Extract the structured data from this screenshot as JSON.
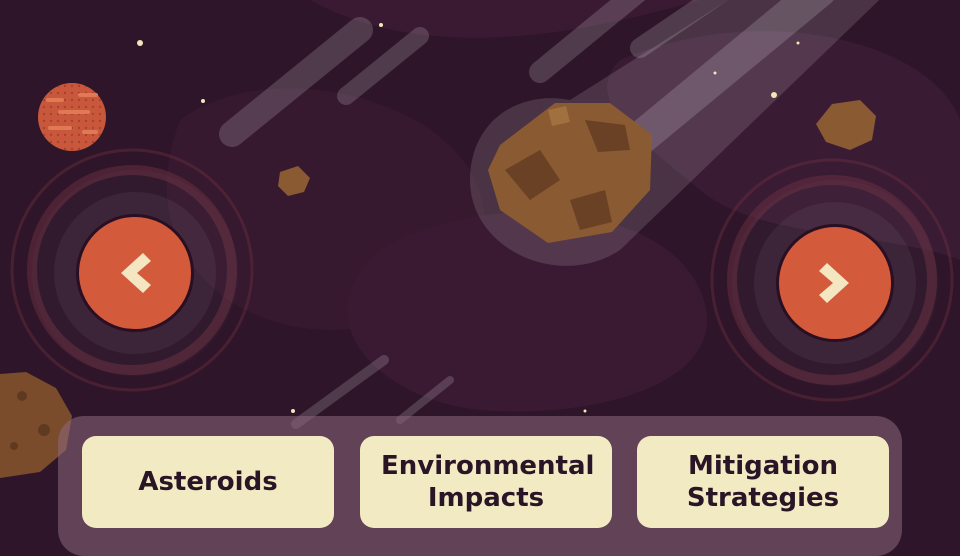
{
  "navigation": {
    "prev_icon": "chevron-left-icon",
    "next_icon": "chevron-right-icon"
  },
  "topics": [
    {
      "label": "Asteroids"
    },
    {
      "label": "Environmental Impacts"
    },
    {
      "label": "Mitigation Strategies"
    }
  ],
  "colors": {
    "background": "#2e1529",
    "button": "#d45a3c",
    "chevron": "#f5e6c2",
    "card": "#f2eac2",
    "card_text": "#2a1527",
    "asteroid": "#8a5a32",
    "planet": "#c8573c"
  }
}
